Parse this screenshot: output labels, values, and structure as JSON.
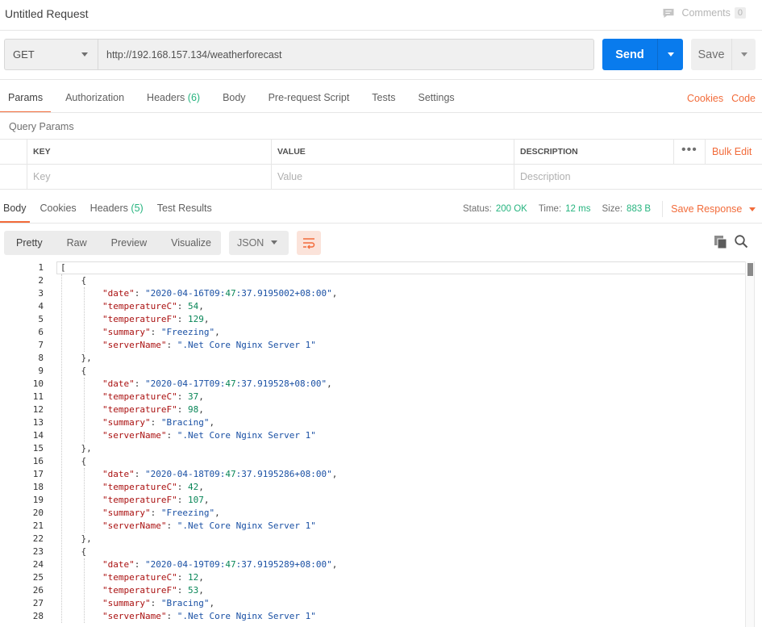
{
  "window": {
    "title": "Untitled Request"
  },
  "comments": {
    "label": "Comments",
    "count": "0"
  },
  "request": {
    "method": "GET",
    "url": "http://192.168.157.134/weatherforecast",
    "send_label": "Send",
    "save_label": "Save"
  },
  "request_tabs": [
    {
      "label": "Params",
      "count": ""
    },
    {
      "label": "Authorization",
      "count": ""
    },
    {
      "label": "Headers",
      "count": "(6)"
    },
    {
      "label": "Body",
      "count": ""
    },
    {
      "label": "Pre-request Script",
      "count": ""
    },
    {
      "label": "Tests",
      "count": ""
    },
    {
      "label": "Settings",
      "count": ""
    }
  ],
  "request_links": {
    "cookies": "Cookies",
    "code": "Code"
  },
  "query_params": {
    "label": "Query Params",
    "headers": {
      "key": "KEY",
      "value": "VALUE",
      "description": "DESCRIPTION"
    },
    "placeholders": {
      "key": "Key",
      "value": "Value",
      "description": "Description"
    },
    "more": "•••",
    "bulk_edit": "Bulk Edit"
  },
  "response_tabs": [
    {
      "label": "Body",
      "count": ""
    },
    {
      "label": "Cookies",
      "count": ""
    },
    {
      "label": "Headers",
      "count": "(5)"
    },
    {
      "label": "Test Results",
      "count": ""
    }
  ],
  "response_status": {
    "status_label": "Status:",
    "status": "200 OK",
    "time_label": "Time:",
    "time": "12 ms",
    "size_label": "Size:",
    "size": "883 B",
    "save_response": "Save Response"
  },
  "body_toolbar": {
    "formats": [
      "Pretty",
      "Raw",
      "Preview",
      "Visualize"
    ],
    "language": "JSON"
  },
  "colors": {
    "accent": "#f26b3a",
    "send": "#097bed",
    "success": "#26b47f",
    "string": "#1a50a4",
    "key": "#a11"
  },
  "icons": {
    "comments": "comment-icon",
    "wrap": "wrap-lines-icon",
    "copy": "copy-icon",
    "search": "search-icon"
  },
  "response_body": {
    "lines": [
      "[",
      "    {",
      "        \"date\": \"2020-04-16T09:47:37.9195002+08:00\",",
      "        \"temperatureC\": 54,",
      "        \"temperatureF\": 129,",
      "        \"summary\": \"Freezing\",",
      "        \"serverName\": \".Net Core Nginx Server 1\"",
      "    },",
      "    {",
      "        \"date\": \"2020-04-17T09:47:37.919528+08:00\",",
      "        \"temperatureC\": 37,",
      "        \"temperatureF\": 98,",
      "        \"summary\": \"Bracing\",",
      "        \"serverName\": \".Net Core Nginx Server 1\"",
      "    },",
      "    {",
      "        \"date\": \"2020-04-18T09:47:37.9195286+08:00\",",
      "        \"temperatureC\": 42,",
      "        \"temperatureF\": 107,",
      "        \"summary\": \"Freezing\",",
      "        \"serverName\": \".Net Core Nginx Server 1\"",
      "    },",
      "    {",
      "        \"date\": \"2020-04-19T09:47:37.9195289+08:00\",",
      "        \"temperatureC\": 12,",
      "        \"temperatureF\": 53,",
      "        \"summary\": \"Bracing\",",
      "        \"serverName\": \".Net Core Nginx Server 1\""
    ]
  }
}
